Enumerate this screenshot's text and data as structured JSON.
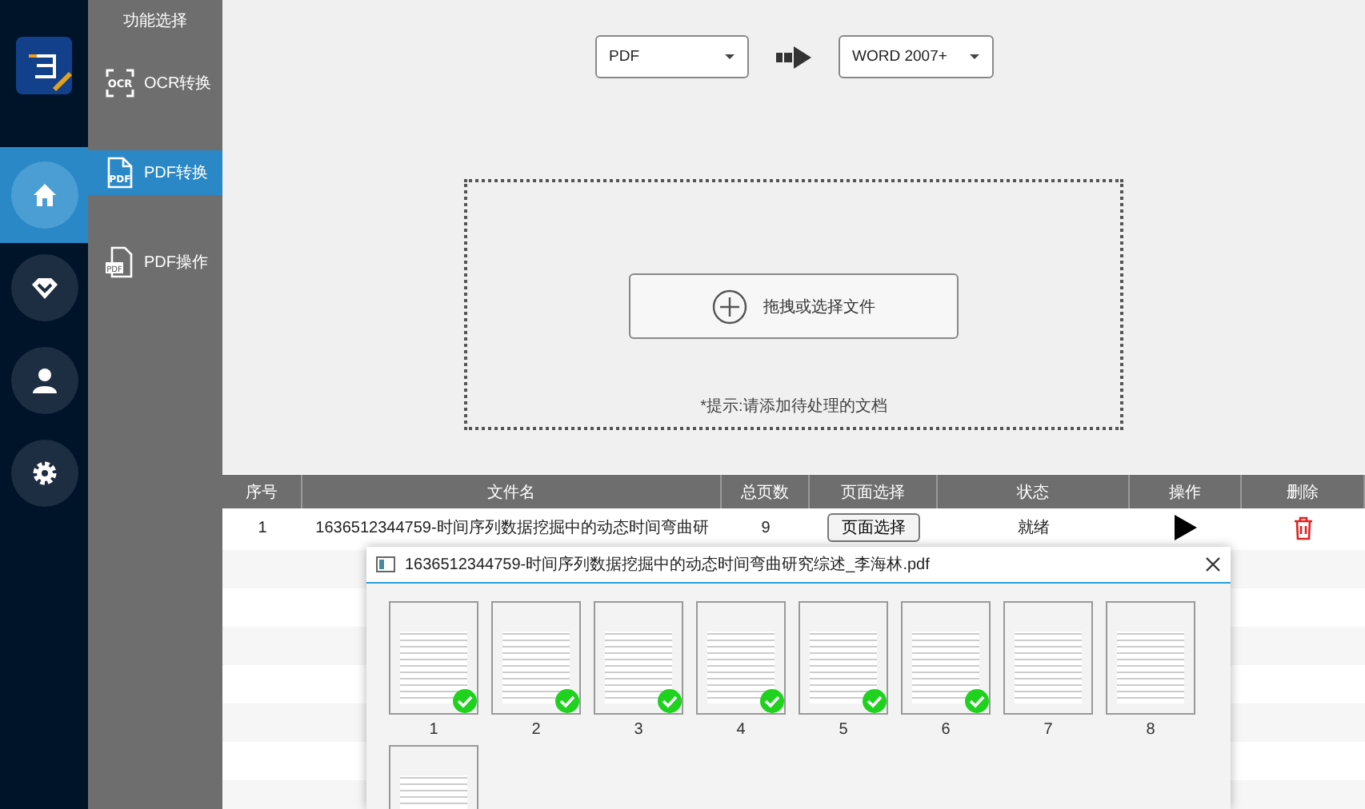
{
  "rail": {
    "items": [
      {
        "kind": "home",
        "selected": true
      },
      {
        "kind": "diamond",
        "selected": false
      },
      {
        "kind": "user",
        "selected": false
      },
      {
        "kind": "settings",
        "selected": false
      }
    ]
  },
  "function_panel": {
    "title": "功能选择",
    "items": [
      {
        "kind": "ocr",
        "icon_text": "OCR",
        "label": "OCR转换",
        "selected": false
      },
      {
        "kind": "pdf",
        "icon_text": "PDF",
        "label": "PDF转换",
        "selected": true
      },
      {
        "kind": "pdf-doc",
        "icon_text": "PDF",
        "label": "PDF操作",
        "selected": false
      }
    ]
  },
  "conversion": {
    "from": "PDF",
    "to": "WORD 2007+"
  },
  "drop_zone": {
    "button": "拖拽或选择文件",
    "hint": "*提示:请添加待处理的文档"
  },
  "table": {
    "columns": [
      "序号",
      "文件名",
      "总页数",
      "页面选择",
      "状态",
      "操作",
      "删除"
    ],
    "rows": [
      {
        "index": "1",
        "file_name": "1636512344759-时间序列数据挖掘中的动态时间弯曲研",
        "pages": "9",
        "page_select": "页面选择",
        "status": "就绪"
      }
    ]
  },
  "dialog": {
    "title": "1636512344759-时间序列数据挖掘中的动态时间弯曲研究综述_李海林.pdf",
    "pages": [
      {
        "label": "1",
        "checked": true
      },
      {
        "label": "2",
        "checked": true
      },
      {
        "label": "3",
        "checked": true
      },
      {
        "label": "4",
        "checked": true
      },
      {
        "label": "5",
        "checked": true
      },
      {
        "label": "6",
        "checked": true
      },
      {
        "label": "7",
        "checked": false
      },
      {
        "label": "8",
        "checked": false
      }
    ],
    "more_pages_below": true
  }
}
